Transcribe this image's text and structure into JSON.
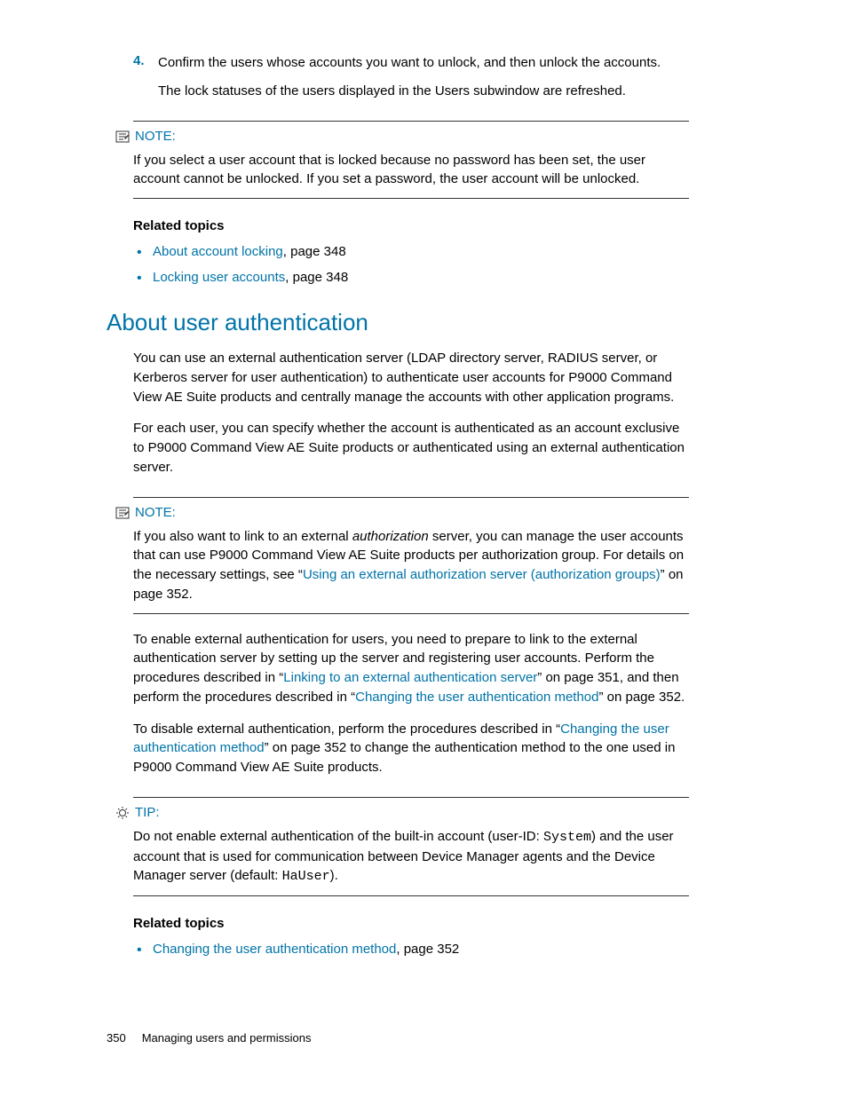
{
  "step": {
    "number": "4.",
    "text": "Confirm the users whose accounts you want to unlock, and then unlock the accounts.",
    "sub": "The lock statuses of the users displayed in the Users subwindow are refreshed."
  },
  "note1": {
    "label": "NOTE:",
    "body": "If you select a user account that is locked because no password has been set, the user account cannot be unlocked. If you set a password, the user account will be unlocked."
  },
  "related1": {
    "heading": "Related topics",
    "items": [
      {
        "link": "About account locking",
        "suffix": ", page 348"
      },
      {
        "link": "Locking user accounts",
        "suffix": ", page 348"
      }
    ]
  },
  "section": {
    "title": "About user authentication",
    "p1": "You can use an external authentication server (LDAP directory server, RADIUS server, or Kerberos server for user authentication) to authenticate user accounts for P9000 Command View AE Suite products and centrally manage the accounts with other application programs.",
    "p2": "For each user, you can specify whether the account is authenticated as an account exclusive to P9000 Command View AE Suite products or authenticated using an external authentication server."
  },
  "note2": {
    "label": "NOTE:",
    "pre": "If you also want to link to an external ",
    "italic": "authorization",
    "mid": " server, you can manage the user accounts that can use P9000 Command View AE Suite products per authorization group. For details on the necessary settings, see “",
    "link": "Using an external authorization server (authorization groups)",
    "post": "” on page 352."
  },
  "para3": {
    "pre": "To enable external authentication for users, you need to prepare to link to the external authentication server by setting up the server and registering user accounts. Perform the procedures described in “",
    "link1": "Linking to an external authentication server",
    "mid": "” on page 351, and then perform the procedures described in “",
    "link2": "Changing the user authentication method",
    "post": "” on page 352."
  },
  "para4": {
    "pre": "To disable external authentication, perform the procedures described in “",
    "link": "Changing the user authentication method",
    "post": "” on page 352 to change the authentication method to the one used in P9000 Command View AE Suite products."
  },
  "tip": {
    "label": "TIP:",
    "t1": "Do not enable external authentication of the built-in account (user-ID: ",
    "m1": "System",
    "t2": ") and the user account that is used for communication between Device Manager agents and the Device Manager server (default: ",
    "m2": "HaUser",
    "t3": ")."
  },
  "related2": {
    "heading": "Related topics",
    "items": [
      {
        "link": "Changing the user authentication method",
        "suffix": ", page 352"
      }
    ]
  },
  "footer": {
    "page": "350",
    "title": "Managing users and permissions"
  }
}
